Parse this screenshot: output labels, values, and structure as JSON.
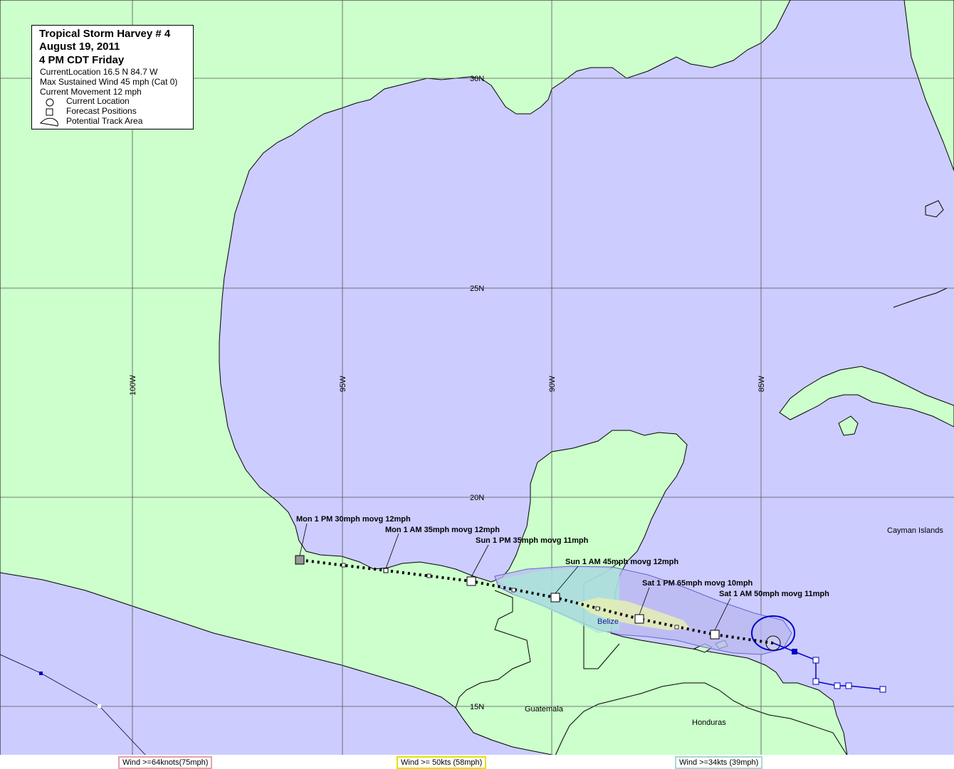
{
  "legend": {
    "title": "Tropical Storm Harvey # 4",
    "date": "August 19, 2011",
    "time": "4 PM CDT Friday",
    "location": "CurrentLocation 16.5 N  84.7 W",
    "wind": "Max Sustained Wind 45 mph (Cat 0)",
    "movement": "Current Movement 12 mph",
    "key_current": "Current Location",
    "key_forecast": "Forecast Positions",
    "key_track": "Potential Track Area"
  },
  "grid": {
    "latitudes": [
      "30N",
      "25N",
      "20N",
      "15N"
    ],
    "longitudes": [
      "100W",
      "95W",
      "90W",
      "85W"
    ]
  },
  "forecast_labels": [
    "Mon 1 PM 30mph movg 12mph",
    "Mon 1 AM 35mph movg 12mph",
    "Sun 1 PM 35mph movg 11mph",
    "Sun 1 AM 45mph movg 12mph",
    "Sat 1 PM 65mph movg 10mph",
    "Sat 1 AM 50mph movg 11mph"
  ],
  "places": {
    "cayman": "Cayman Islands",
    "belize": "Belize",
    "guatemala": "Guatemala",
    "honduras": "Honduras"
  },
  "footer": {
    "wind64": "Wind >=64knots(75mph)",
    "wind50": "Wind >= 50kts (58mph)",
    "wind34": "Wind >=34kts (39mph)",
    "wind64_color": "#e8a0a8",
    "wind50_color": "#e8e000",
    "wind34_color": "#a8d8d8"
  },
  "colors": {
    "water": "#ccccff",
    "land": "#ccffcc",
    "track_area": "#b8b8f0",
    "track": "#000000",
    "past_track": "#0000cc"
  }
}
